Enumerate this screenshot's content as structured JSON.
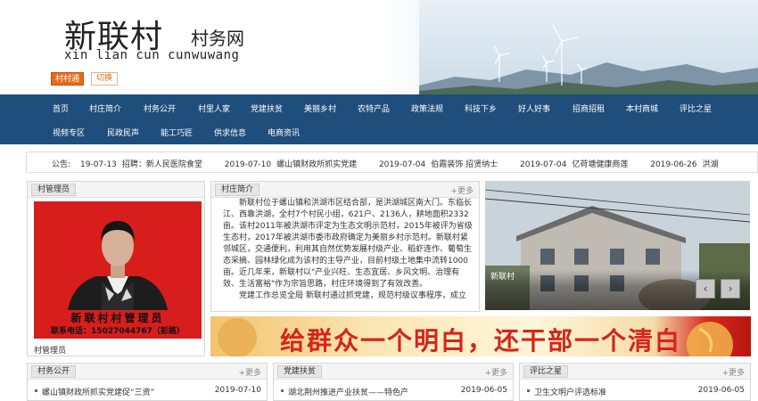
{
  "header": {
    "site_name": "新联村",
    "site_suffix": "村务网",
    "pinyin": "xin  lian cun cunwuwang",
    "cct_label": "村村通",
    "switch_label": "切换"
  },
  "nav": {
    "row1": [
      "首页",
      "村庄简介",
      "村务公开",
      "村里人家",
      "党建扶贫",
      "美丽乡村",
      "农特产品",
      "政策法规",
      "科技下乡",
      "好人好事",
      "招商招租",
      "本村商城",
      "评比之星"
    ],
    "row2": [
      "视频专区",
      "民政民声",
      "能工巧匠",
      "供求信息",
      "电商资讯"
    ]
  },
  "notice": {
    "label": "公告:",
    "items": [
      {
        "date": "19-07-13",
        "text": "招聘：新人民医院食堂"
      },
      {
        "date": "2019-07-10",
        "text": "螺山镇财政所抓实党建"
      },
      {
        "date": "2019-07-04",
        "text": "伯霞装饰 招贤纳士"
      },
      {
        "date": "2019-07-04",
        "text": "亿荷塘健康商莲"
      },
      {
        "date": "2019-06-26",
        "text": "洪湖"
      }
    ]
  },
  "manager_panel": {
    "title": "村管理员",
    "caption_name": "新联村村管理员",
    "caption_phone": "联系电话：15027044767（彭路）",
    "label": "村管理员"
  },
  "intro_panel": {
    "title": "村庄简介",
    "more": "更多",
    "text": "新联村位于螺山镇和洪湖市区结合部，是洪湖城区南大门。东临长江、西靠洪湖，全村7个村民小组，621户、2136人，耕地面积2332亩。该村2011年被洪湖市评定为生态文明示范村，2015年被评为省级生态村，2017年被洪湖市委市政府确定为美丽乡村示范村。新联村紧邻城区，交通便利，利用其自然优势发展村级产业、稻虾连作、葡萄生态采摘、园林绿化成为该村的主导产业，目前村级土地集中流转1000亩。近几年来，新联村以\"产业兴旺、生态宜居、乡风文明、治理有效、生活富裕\"作为宗旨思路，村庄环境得到了有效改善。",
    "text2": "党建工作总览全局  新联村通过抓党建，规范村级议事程序，成立"
  },
  "scene": {
    "label": "新联村",
    "prev": "‹",
    "next": "›"
  },
  "banner": {
    "text": "给群众一个明白，还干部一个清白"
  },
  "bottom_panels": [
    {
      "title": "村务公开",
      "more": "更多",
      "items": [
        {
          "text": "螺山镇财政所抓实党建促“三资”",
          "date": "2019-07-10"
        }
      ]
    },
    {
      "title": "党建扶贫",
      "more": "更多",
      "items": [
        {
          "text": "湖北荆州推进产业扶贫——特色产",
          "date": "2019-06-05"
        }
      ]
    },
    {
      "title": "评比之星",
      "more": "更多",
      "items": [
        {
          "text": "卫生文明户评选标准",
          "date": "2019-06-05"
        }
      ]
    }
  ],
  "colors": {
    "nav_bg": "#1f4e7c",
    "accent_orange": "#e86a1a",
    "photo_red": "#d81d1d",
    "banner_red": "#d6241b"
  }
}
